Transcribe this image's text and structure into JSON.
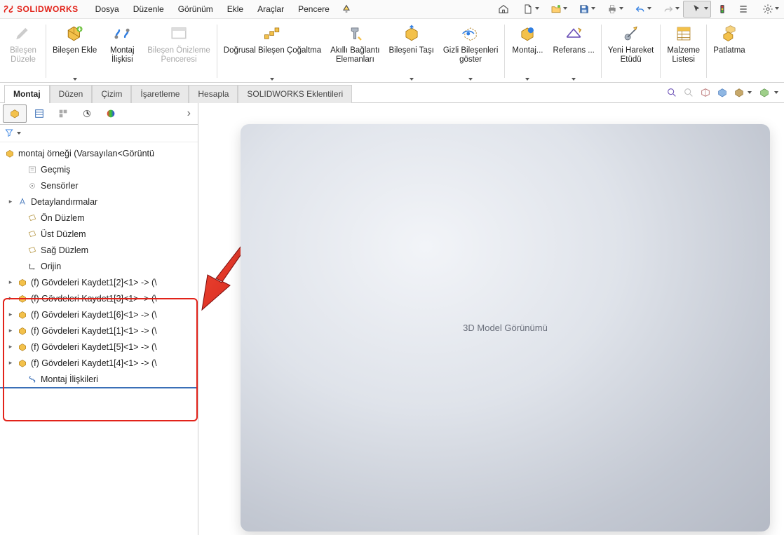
{
  "brand": "SOLIDWORKS",
  "menu": {
    "items": [
      "Dosya",
      "Düzenle",
      "Görünüm",
      "Ekle",
      "Araçlar",
      "Pencere"
    ]
  },
  "quick_icons": [
    "home",
    "newdoc",
    "open",
    "save",
    "print",
    "undo",
    "redo",
    "select",
    "gauge",
    "list",
    "gear"
  ],
  "ribbon": [
    {
      "name": "bilesen-duzele",
      "label": "Bileşen\nDüzele",
      "icon": "comp-edit",
      "disabled": true
    },
    {
      "name": "bilesen-ekle",
      "label": "Bileşen Ekle",
      "icon": "comp-add",
      "drop": true
    },
    {
      "name": "montaj-iliskisi",
      "label": "Montaj\nİlişkisi",
      "icon": "mate"
    },
    {
      "name": "bilesen-onizleme",
      "label": "Bileşen Önizleme\nPenceresi",
      "icon": "preview",
      "disabled": true
    },
    {
      "name": "dogrusal-cogaltma",
      "label": "Doğrusal Bileşen Çoğaltma",
      "icon": "linear",
      "drop": true
    },
    {
      "name": "akilli-baglanti",
      "label": "Akıllı Bağlantı\nElemanları",
      "icon": "smart"
    },
    {
      "name": "bileseni-tasi",
      "label": "Bileşeni Taşı",
      "icon": "move",
      "drop": true
    },
    {
      "name": "gizli-goster",
      "label": "Gizli Bileşenleri\ngöster",
      "icon": "showhidden",
      "drop": true
    },
    {
      "name": "montaj-ozel",
      "label": "Montaj...",
      "icon": "asm-feat",
      "drop": true
    },
    {
      "name": "referans",
      "label": "Referans ...",
      "icon": "refgeom",
      "drop": true
    },
    {
      "name": "yeni-hareket",
      "label": "Yeni Hareket\nEtüdü",
      "icon": "motion"
    },
    {
      "name": "malzeme-listesi",
      "label": "Malzeme\nListesi",
      "icon": "bom"
    },
    {
      "name": "patlatma",
      "label": "Patlatma",
      "icon": "explode"
    }
  ],
  "ribbon_tabs": [
    "Montaj",
    "Düzen",
    "Çizim",
    "İşaretleme",
    "Hesapla",
    "SOLIDWORKS Eklentileri"
  ],
  "active_ribbon_tab": "Montaj",
  "tree": {
    "root": "montaj örneği  (Varsayılan<Görüntü",
    "nodes": [
      {
        "icon": "history",
        "label": "Geçmiş",
        "exp": ""
      },
      {
        "icon": "sensor",
        "label": "Sensörler",
        "exp": ""
      },
      {
        "icon": "annot",
        "label": "Detaylandırmalar",
        "exp": "▸"
      },
      {
        "icon": "plane",
        "label": "Ön Düzlem",
        "exp": ""
      },
      {
        "icon": "plane",
        "label": "Üst Düzlem",
        "exp": ""
      },
      {
        "icon": "plane",
        "label": "Sağ Düzlem",
        "exp": ""
      },
      {
        "icon": "origin",
        "label": "Orijin",
        "exp": ""
      }
    ],
    "parts": [
      "(f) Gövdeleri Kaydet1[2]<1> -> (\\",
      "(f) Gövdeleri Kaydet1[3]<1> -> (\\",
      "(f) Gövdeleri Kaydet1[6]<1> -> (\\",
      "(f) Gövdeleri Kaydet1[1]<1> -> (\\",
      "(f) Gövdeleri Kaydet1[5]<1> -> (\\",
      "(f) Gövdeleri Kaydet1[4]<1> -> (\\"
    ],
    "mates_label": "Montaj İlişkileri"
  },
  "viewport_placeholder": "3D Model Görünümü"
}
